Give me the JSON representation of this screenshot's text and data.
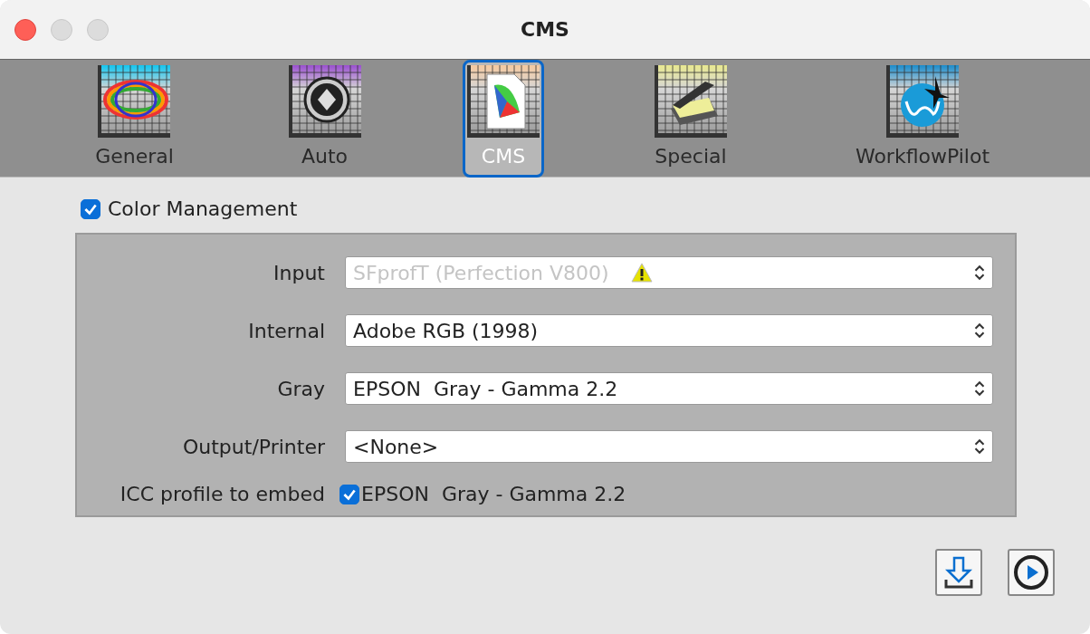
{
  "window": {
    "title": "CMS"
  },
  "tabs": [
    {
      "label": "General",
      "selected": false
    },
    {
      "label": "Auto",
      "selected": false
    },
    {
      "label": "CMS",
      "selected": true
    },
    {
      "label": "Special",
      "selected": false
    },
    {
      "label": "WorkflowPilot",
      "selected": false
    }
  ],
  "color_management": {
    "label": "Color Management",
    "checked": true
  },
  "profiles": [
    {
      "label": "Input",
      "value": "SFprofT (Perfection V800)",
      "disabled": true,
      "warning": true
    },
    {
      "label": "Internal",
      "value": "Adobe RGB (1998)",
      "disabled": false,
      "warning": false
    },
    {
      "label": "Gray",
      "value": "EPSON  Gray - Gamma 2.2",
      "disabled": false,
      "warning": false
    },
    {
      "label": "Output/Printer",
      "value": "<None>",
      "disabled": false,
      "warning": false
    }
  ],
  "embed": {
    "label": "ICC profile to embed",
    "checked": true,
    "value": "EPSON  Gray - Gamma 2.2"
  }
}
